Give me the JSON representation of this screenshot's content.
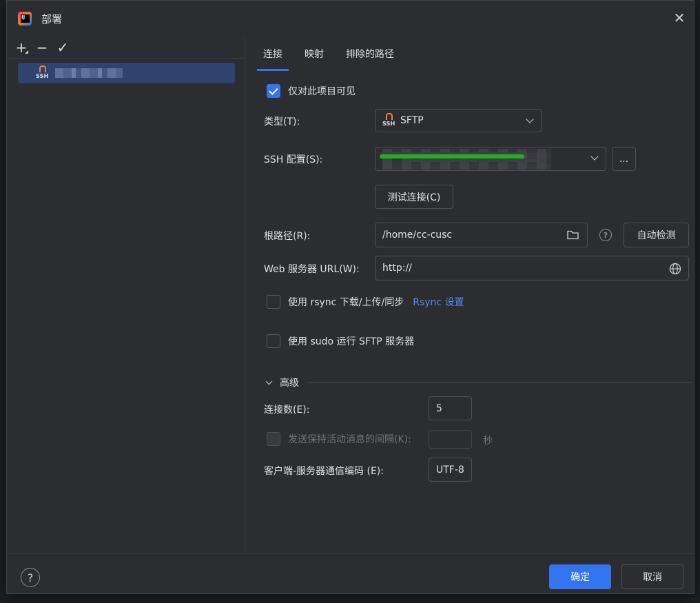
{
  "window": {
    "title": "部署",
    "close_glyph": "✕"
  },
  "left_toolbar": {
    "add_glyph": "+",
    "remove_glyph": "−",
    "apply_glyph": "✓"
  },
  "server_list": {
    "items": [
      {
        "type_label": "SSH",
        "name": ""
      }
    ]
  },
  "tabs": [
    {
      "label": "连接",
      "active": true
    },
    {
      "label": "映射",
      "active": false
    },
    {
      "label": "排除的路径",
      "active": false
    }
  ],
  "connection": {
    "visible_only_project": {
      "label": "仅对此项目可见",
      "checked": true
    },
    "type": {
      "label": "类型(T):",
      "value": "SFTP",
      "icon_label": "SSH"
    },
    "ssh_config": {
      "label": "SSH 配置(S):",
      "value": "",
      "more_label": "..."
    },
    "test_button": "测试连接(C)",
    "root_path": {
      "label": "根路径(R):",
      "value": "/home/cc-cusc",
      "autodetect_label": "自动检测",
      "help_glyph": "?"
    },
    "web_url": {
      "label": "Web 服务器 URL(W):",
      "value": "http://"
    },
    "rsync": {
      "label": "使用 rsync 下载/上传/同步",
      "checked": false,
      "link": "Rsync 设置"
    },
    "sudo": {
      "label": "使用 sudo 运行 SFTP 服务器",
      "checked": false
    }
  },
  "advanced": {
    "header": "高级",
    "connections": {
      "label": "连接数(E):",
      "value": "5"
    },
    "keepalive": {
      "label": "发送保持活动消息的间隔(K):",
      "value": "",
      "unit": "秒",
      "checked": false,
      "enabled": false
    },
    "encoding": {
      "label": "客户端-服务器通信编码 (E):",
      "value": "UTF-8"
    }
  },
  "footer": {
    "help_glyph": "?",
    "ok_label": "确定",
    "cancel_label": "取消"
  },
  "colors": {
    "accent": "#3574f0",
    "background": "#2b2d30",
    "link": "#548af7"
  }
}
